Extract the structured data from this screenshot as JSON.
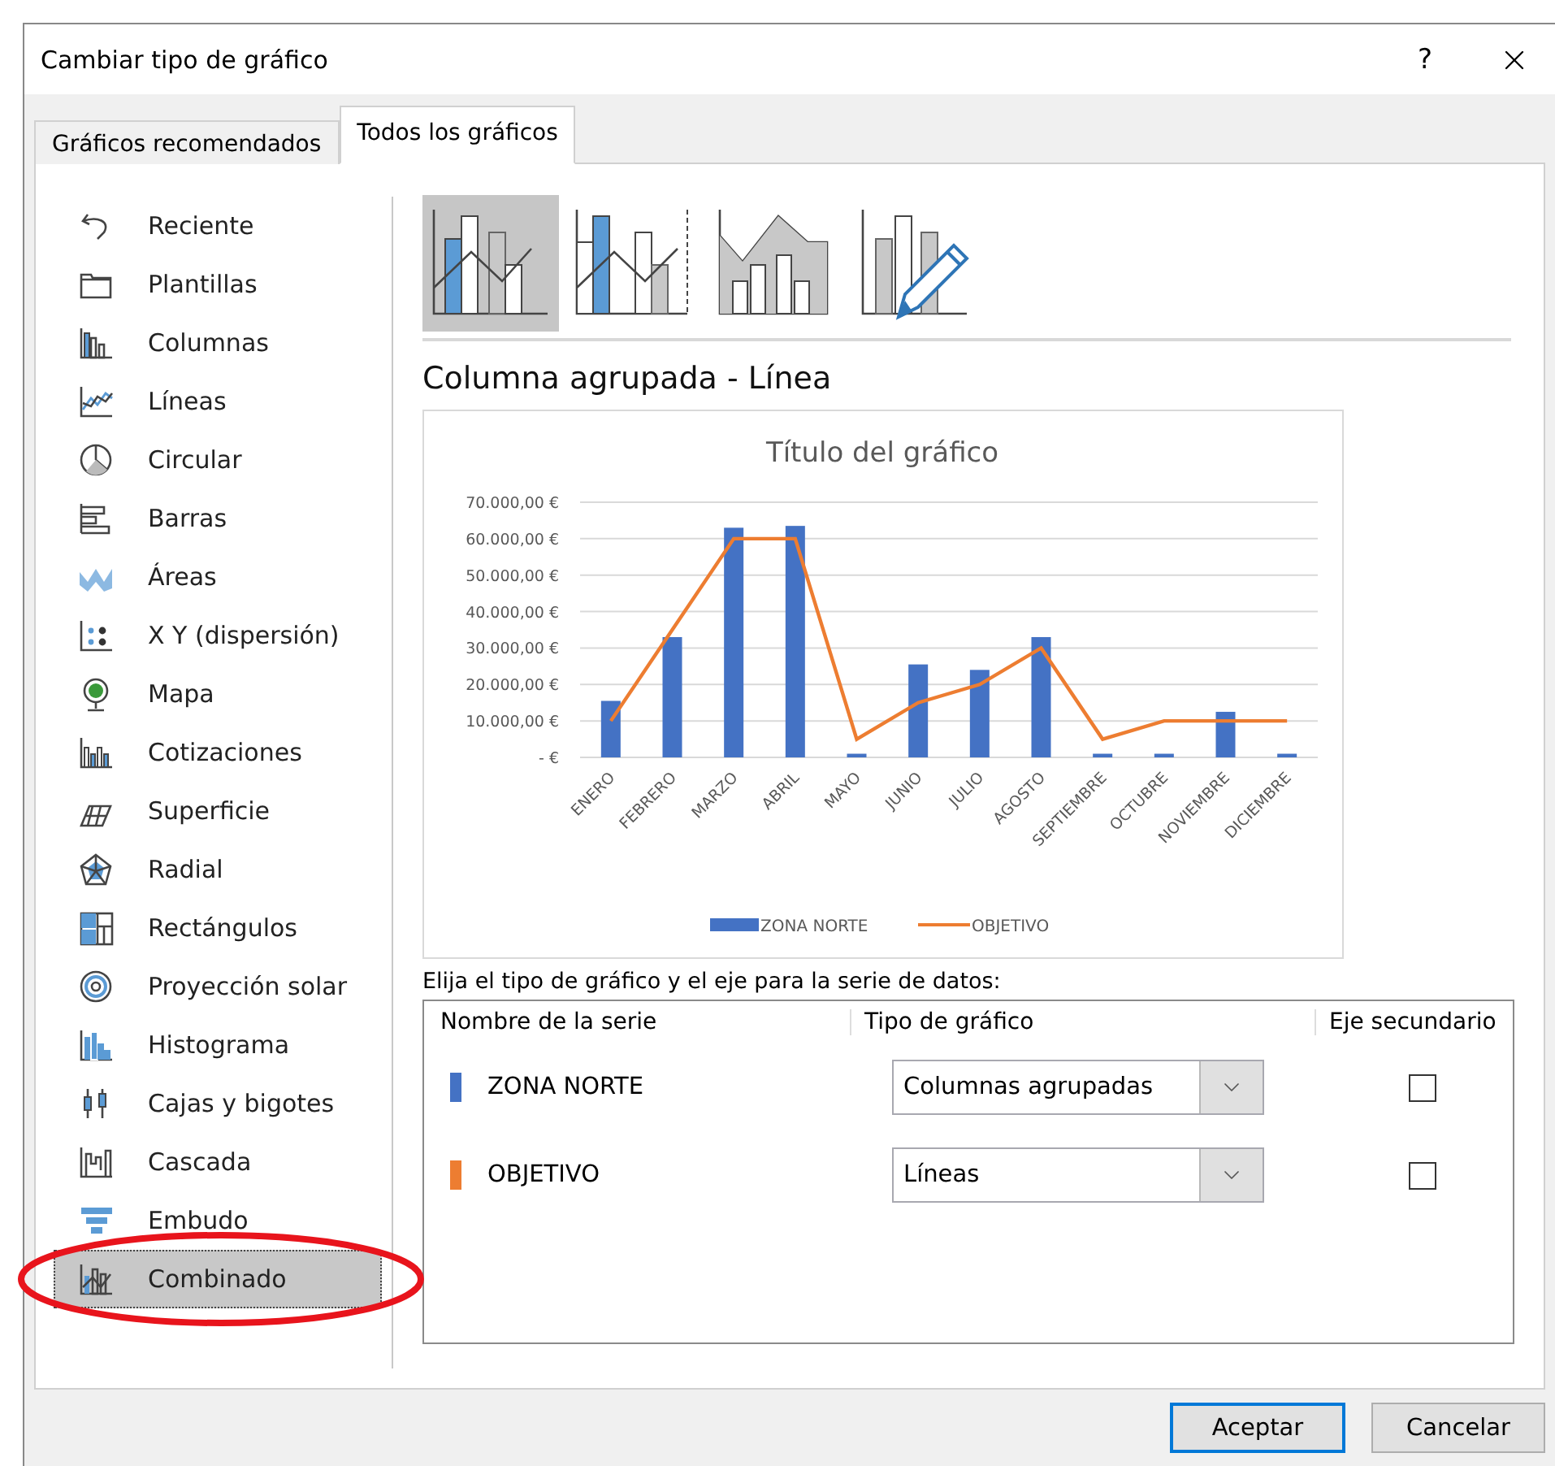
{
  "window": {
    "title": "Cambiar tipo de gráfico",
    "help": "?"
  },
  "tabs": [
    {
      "label": "Gráficos recomendados",
      "selected": false
    },
    {
      "label": "Todos los gráficos",
      "selected": true
    }
  ],
  "sidebar": {
    "items": [
      {
        "label": "Reciente",
        "selected": false,
        "circled": false
      },
      {
        "label": "Plantillas",
        "selected": false,
        "circled": false
      },
      {
        "label": "Columnas",
        "selected": false,
        "circled": false
      },
      {
        "label": "Líneas",
        "selected": false,
        "circled": false
      },
      {
        "label": "Circular",
        "selected": false,
        "circled": false
      },
      {
        "label": "Barras",
        "selected": false,
        "circled": false
      },
      {
        "label": "Áreas",
        "selected": false,
        "circled": false
      },
      {
        "label": "X Y (dispersión)",
        "selected": false,
        "circled": false
      },
      {
        "label": "Mapa",
        "selected": false,
        "circled": false
      },
      {
        "label": "Cotizaciones",
        "selected": false,
        "circled": false
      },
      {
        "label": "Superficie",
        "selected": false,
        "circled": false
      },
      {
        "label": "Radial",
        "selected": false,
        "circled": false
      },
      {
        "label": "Rectángulos",
        "selected": false,
        "circled": false
      },
      {
        "label": "Proyección solar",
        "selected": false,
        "circled": false
      },
      {
        "label": "Histograma",
        "selected": false,
        "circled": false
      },
      {
        "label": "Cajas y bigotes",
        "selected": false,
        "circled": false
      },
      {
        "label": "Cascada",
        "selected": false,
        "circled": false
      },
      {
        "label": "Embudo",
        "selected": false,
        "circled": false
      },
      {
        "label": "Combinado",
        "selected": true,
        "circled": true
      }
    ]
  },
  "subtypes": [
    {
      "selected": true
    },
    {
      "selected": false
    },
    {
      "selected": false
    },
    {
      "selected": false
    }
  ],
  "subtype_title": "Columna agrupada - Línea",
  "preview": {
    "chart_data": {
      "type": "bar",
      "title": "Título del gráfico",
      "categories": [
        "ENERO",
        "FEBRERO",
        "MARZO",
        "ABRIL",
        "MAYO",
        "JUNIO",
        "JULIO",
        "AGOSTO",
        "SEPTIEMBRE",
        "OCTUBRE",
        "NOVIEMBRE",
        "DICIEMBRE"
      ],
      "stacked": false,
      "grid": true,
      "legend": "bottom",
      "series": [
        {
          "name": "ZONA NORTE",
          "type": "bar",
          "color": "#4472c4",
          "values": [
            15500,
            33000,
            63000,
            63500,
            1000,
            25500,
            24000,
            33000,
            1000,
            1000,
            12500,
            1000
          ]
        },
        {
          "name": "OBJETIVO",
          "type": "line",
          "color": "#ed7d31",
          "values": [
            10000,
            35000,
            60000,
            60000,
            5000,
            15000,
            20000,
            30000,
            5000,
            10000,
            10000,
            10000
          ]
        }
      ],
      "ylim": [
        0,
        70000
      ],
      "yticks": [
        {
          "value": 0,
          "label": "-   €"
        },
        {
          "value": 10000,
          "label": "10.000,00 €"
        },
        {
          "value": 20000,
          "label": "20.000,00 €"
        },
        {
          "value": 30000,
          "label": "30.000,00 €"
        },
        {
          "value": 40000,
          "label": "40.000,00 €"
        },
        {
          "value": 50000,
          "label": "50.000,00 €"
        },
        {
          "value": 60000,
          "label": "60.000,00 €"
        },
        {
          "value": 70000,
          "label": "70.000,00 €"
        }
      ]
    }
  },
  "series_prompt": "Elija el tipo de gráfico y el eje para la serie de datos:",
  "series_table": {
    "columns": [
      "Nombre de la serie",
      "Tipo de gráfico",
      "Eje secundario"
    ],
    "rows": [
      {
        "name": "ZONA NORTE",
        "color": "#4472c4",
        "chart_type": "Columnas agrupadas",
        "secondary_axis": false
      },
      {
        "name": "OBJETIVO",
        "color": "#ed7d31",
        "chart_type": "Líneas",
        "secondary_axis": false
      }
    ]
  },
  "buttons": [
    {
      "label": "Aceptar",
      "default": true
    },
    {
      "label": "Cancelar",
      "default": false
    }
  ]
}
